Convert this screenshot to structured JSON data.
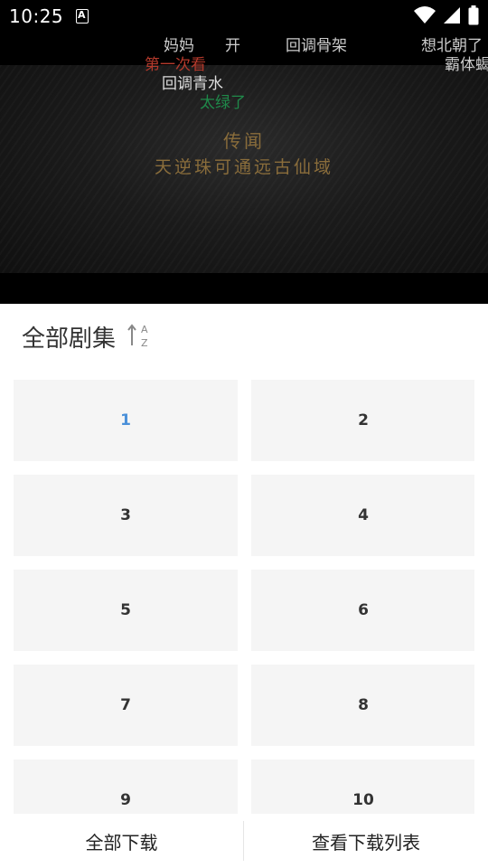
{
  "status_bar": {
    "time": "10:25",
    "icons": [
      "wifi-icon",
      "cellular-signal-icon",
      "battery-icon"
    ]
  },
  "video": {
    "title_line1": "传闻",
    "title_line2": "天逆珠可通远古仙域",
    "danmaku": [
      {
        "text": "妈妈",
        "color": "#cccccc"
      },
      {
        "text": "开",
        "color": "#cccccc"
      },
      {
        "text": "回调骨架",
        "color": "#cccccc"
      },
      {
        "text": "想北朝了",
        "color": "#cccccc"
      },
      {
        "text": "第一次看",
        "color": "#b53a2c"
      },
      {
        "text": "霸体蝎",
        "color": "#cccccc"
      },
      {
        "text": "回调青水",
        "color": "#dddddd"
      },
      {
        "text": "太绿了",
        "color": "#1f8a4a"
      }
    ]
  },
  "sheet": {
    "title": "全部剧集",
    "sort_icon": "sort-az-icon",
    "episodes": [
      "1",
      "2",
      "3",
      "4",
      "5",
      "6",
      "7",
      "8",
      "9",
      "10"
    ],
    "selected_episode": "1",
    "accent_color": "#4a90d9"
  },
  "bottom": {
    "download_all": "全部下载",
    "view_list": "查看下载列表"
  }
}
